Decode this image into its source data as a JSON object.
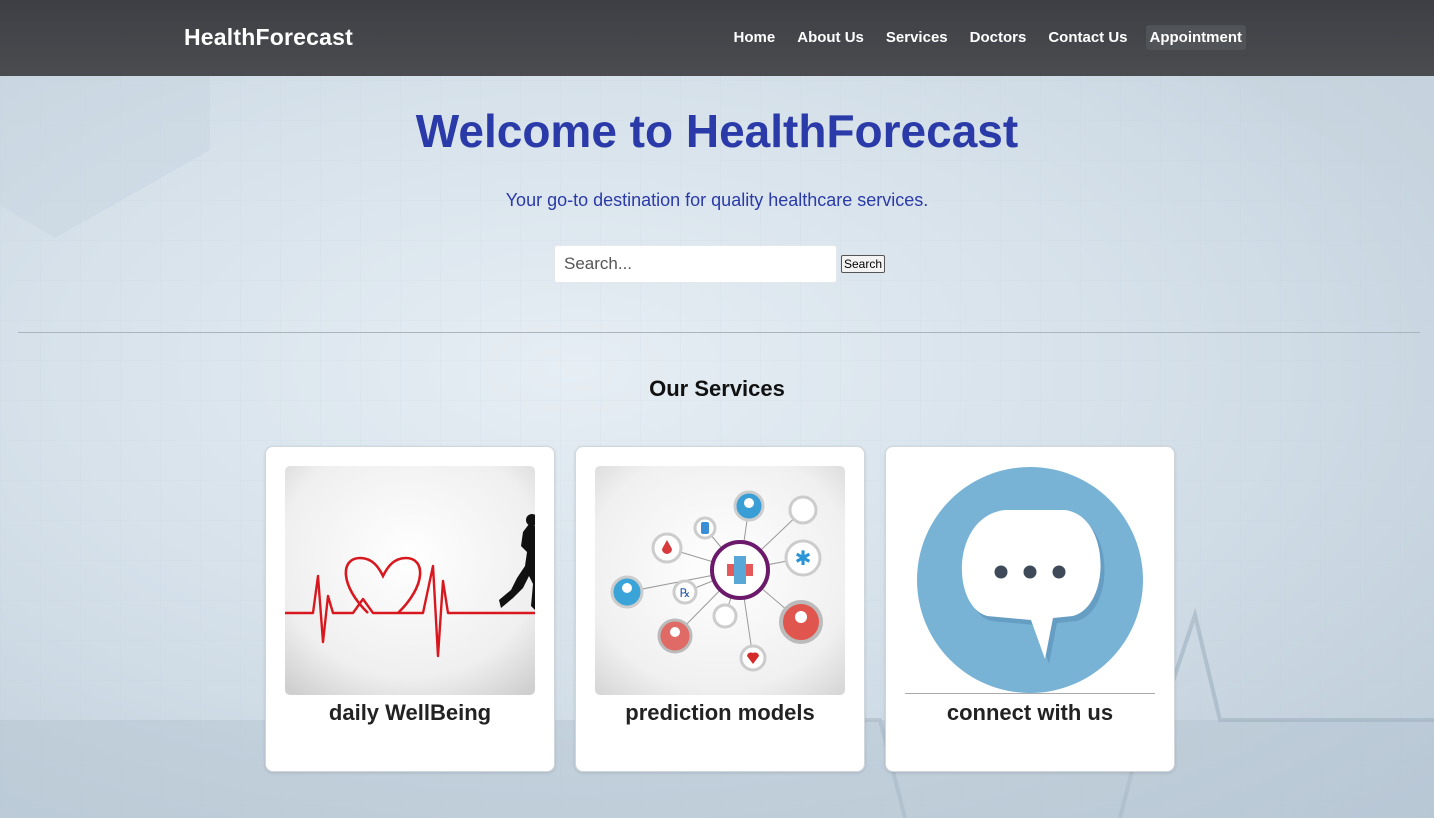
{
  "nav": {
    "logo": "HealthForecast",
    "links": [
      "Home",
      "About Us",
      "Services",
      "Doctors",
      "Contact Us",
      "Appointment"
    ],
    "active_link": "Appointment"
  },
  "hero": {
    "title": "Welcome to HealthForecast",
    "subtitle": "Your go-to destination for quality healthcare services."
  },
  "search": {
    "placeholder": "Search...",
    "button_label": "Search"
  },
  "services": {
    "heading": "Our Services",
    "cards": [
      {
        "title": "daily WellBeing",
        "image": "heartbeat-runner-image"
      },
      {
        "title": "prediction models",
        "image": "medical-network-image"
      },
      {
        "title": "connect with us",
        "image": "chat-bubble-image"
      }
    ]
  },
  "colors": {
    "navbar": "#45474b",
    "heading_blue": "#2a3aa8",
    "heartbeat_red": "#d8181f",
    "chat_blue": "#78b3d6"
  }
}
